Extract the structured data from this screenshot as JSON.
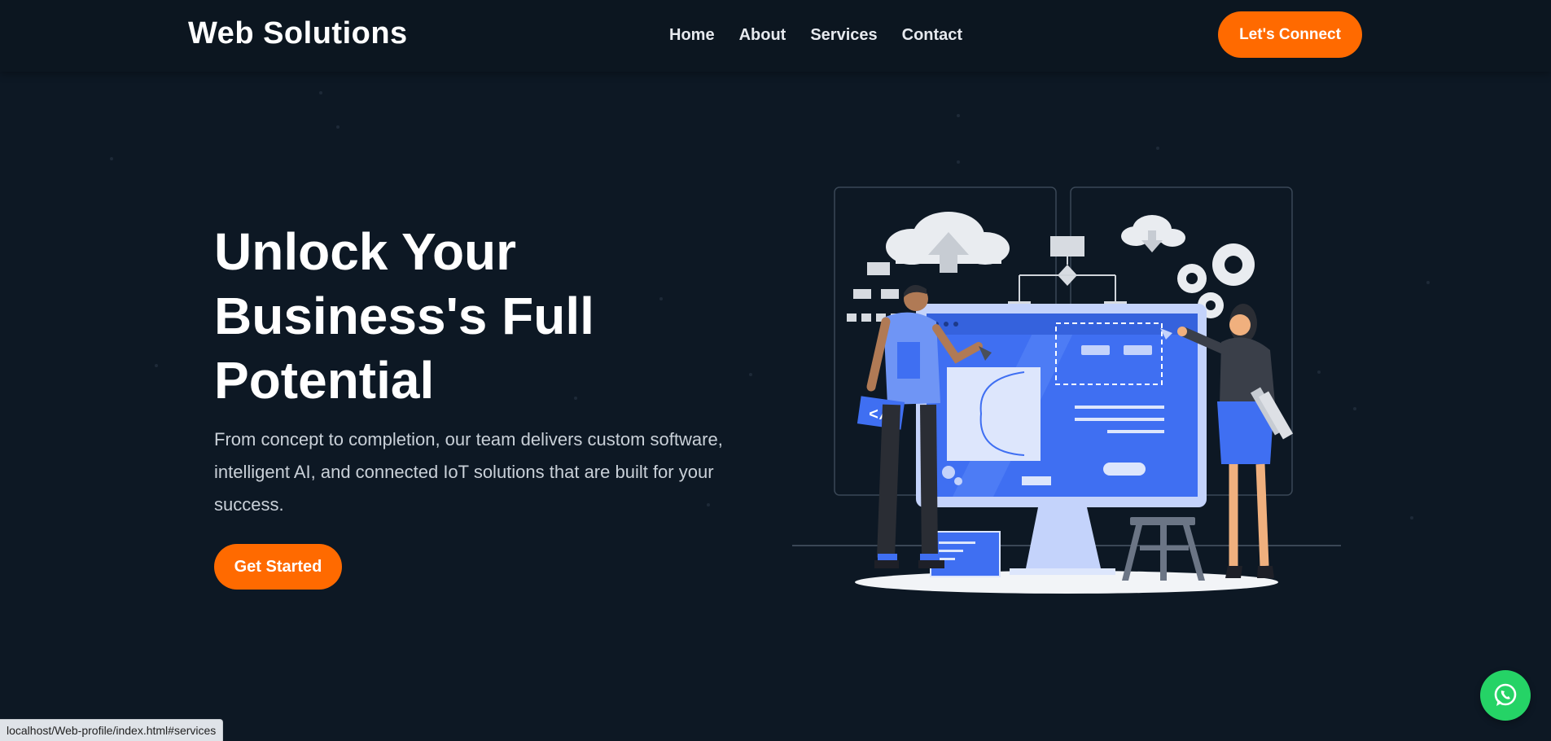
{
  "header": {
    "brand": "Web Solutions",
    "nav": [
      "Home",
      "About",
      "Services",
      "Contact"
    ],
    "cta_label": "Let's Connect"
  },
  "hero": {
    "title_lines": [
      "Unlock Your",
      "Business's Full",
      "Potential"
    ],
    "subtitle": "From concept to completion, our team delivers custom software, intelligent AI, and connected IoT solutions that are built for your success.",
    "button_label": "Get Started",
    "illustration": "team-designing-website-illustration"
  },
  "status_bar": {
    "url": "localhost/Web-profile/index.html#services"
  },
  "floating": {
    "icon": "whatsapp-icon"
  },
  "colors": {
    "background": "#0d1824",
    "header": "#0c1620",
    "accent": "#ff6a00",
    "illustration_blue": "#3f6ff2",
    "whatsapp": "#25d366"
  }
}
